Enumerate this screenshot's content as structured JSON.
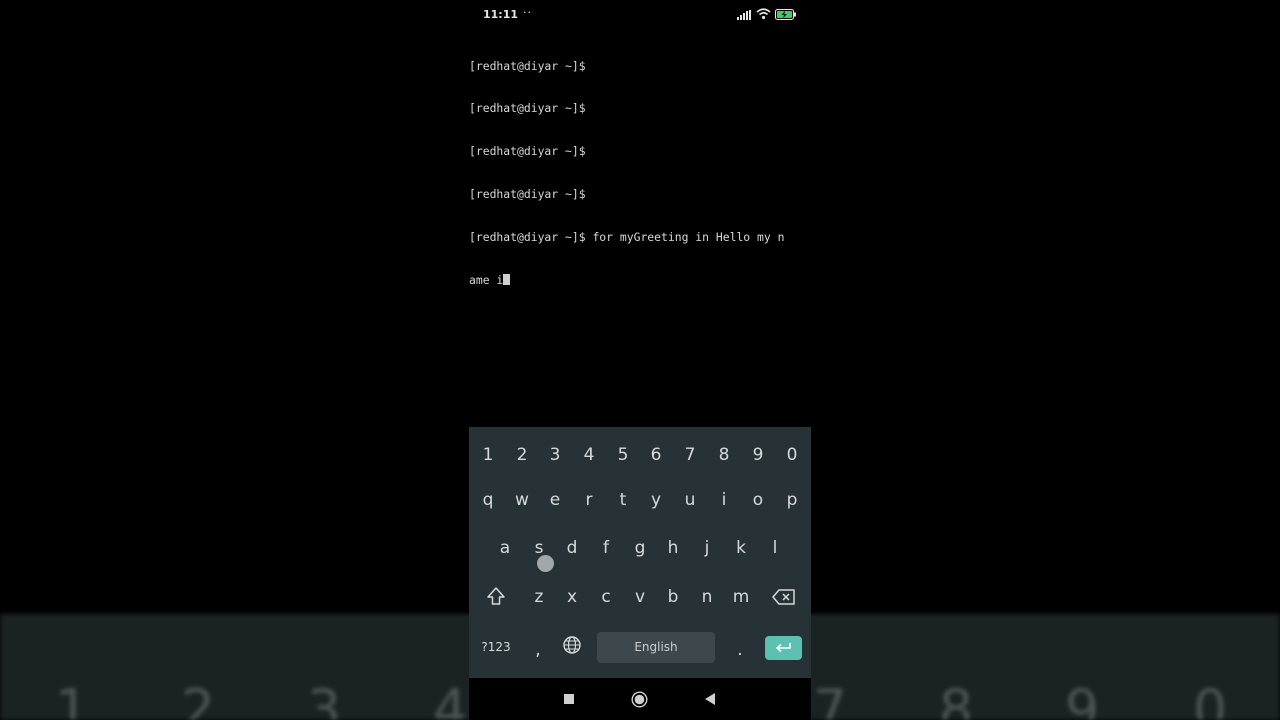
{
  "status_bar": {
    "time": "11:11",
    "extra": "··",
    "icons": [
      "signal-icon",
      "wifi-icon",
      "battery-charging-icon"
    ],
    "battery_color": "#3ecf5a"
  },
  "terminal": {
    "lines": [
      "[redhat@diyar ~]$",
      "[redhat@diyar ~]$",
      "[redhat@diyar ~]$",
      "[redhat@diyar ~]$",
      "[redhat@diyar ~]$ for myGreeting in Hello my n",
      "ame i"
    ]
  },
  "keyboard": {
    "numbers": [
      "1",
      "2",
      "3",
      "4",
      "5",
      "6",
      "7",
      "8",
      "9",
      "0"
    ],
    "row1": [
      "q",
      "w",
      "e",
      "r",
      "t",
      "y",
      "u",
      "i",
      "o",
      "p"
    ],
    "row2": [
      "a",
      "s",
      "d",
      "f",
      "g",
      "h",
      "j",
      "k",
      "l"
    ],
    "row3": [
      "z",
      "x",
      "c",
      "v",
      "b",
      "n",
      "m"
    ],
    "symbols_label": "?123",
    "comma_label": ",",
    "period_label": ".",
    "space_label": "English",
    "accent_color": "#5cc1b2"
  },
  "background": {
    "digits": [
      "1",
      "2",
      "3",
      "4",
      "7",
      "8",
      "9",
      "0"
    ]
  }
}
